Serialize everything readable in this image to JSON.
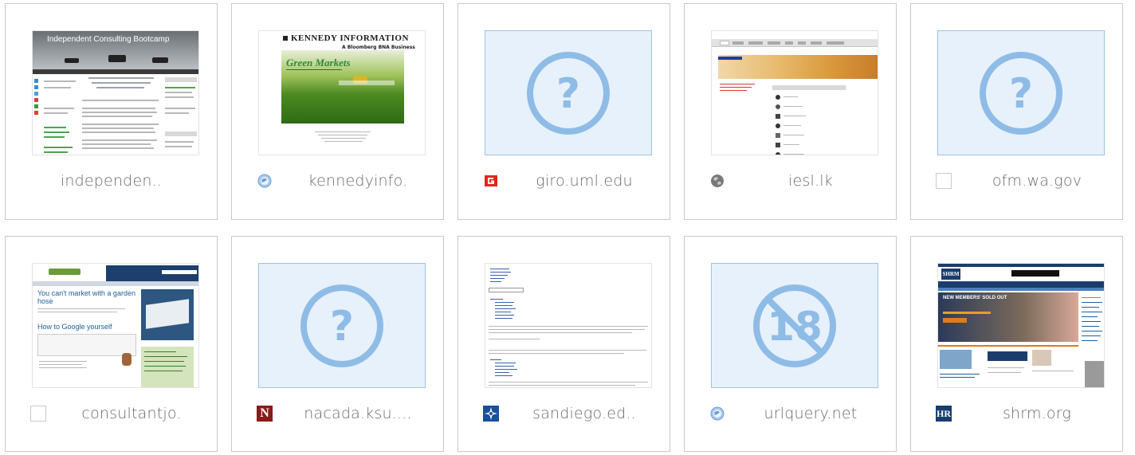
{
  "cards": [
    {
      "domain": "independen..",
      "favicon": "none",
      "thumb": "independent-consulting",
      "thumb_title": "Independent Consulting Bootcamp"
    },
    {
      "domain": "kennedyinfo.",
      "favicon": "globe-icon",
      "thumb": "kennedy",
      "thumb_title": "KENNEDY INFORMATION",
      "thumb_subtitle": "A Bloomberg BNA Business",
      "thumb_tag": "Green Markets"
    },
    {
      "domain": "giro.uml.edu",
      "favicon": "g-logo-icon",
      "thumb": "question-placeholder",
      "placeholder_glyph": "?"
    },
    {
      "domain": "iesl.lk",
      "favicon": "earth-icon",
      "thumb": "iesl"
    },
    {
      "domain": "ofm.wa.gov",
      "favicon": "blank-icon",
      "thumb": "question-placeholder",
      "placeholder_glyph": "?"
    },
    {
      "domain": "consultantjo.",
      "favicon": "blank-icon",
      "thumb": "consultant-journal",
      "thumb_headline": "You can't market with a garden hose",
      "thumb_headline2": "How to Google yourself"
    },
    {
      "domain": "nacada.ksu....",
      "favicon": "n-logo-icon",
      "favicon_text": "N",
      "thumb": "question-placeholder",
      "placeholder_glyph": "?"
    },
    {
      "domain": "sandiego.ed..",
      "favicon": "compass-icon",
      "thumb": "sandiego"
    },
    {
      "domain": "urlquery.net",
      "favicon": "globe-icon",
      "thumb": "age-restricted-placeholder",
      "placeholder_glyph": "18"
    },
    {
      "domain": "shrm.org",
      "favicon": "hr-logo-icon",
      "favicon_text": "HR",
      "thumb": "shrm",
      "thumb_logo": "SHRM",
      "thumb_banner": "NEW MEMBERS' SOLD OUT"
    }
  ],
  "colors": {
    "card_border": "#c9c9c9",
    "placeholder_bg": "#e7f1fb",
    "placeholder_icon": "#8fbce6",
    "domain_text": "#6b6b6b",
    "green_markets": "#2f8a3a"
  }
}
